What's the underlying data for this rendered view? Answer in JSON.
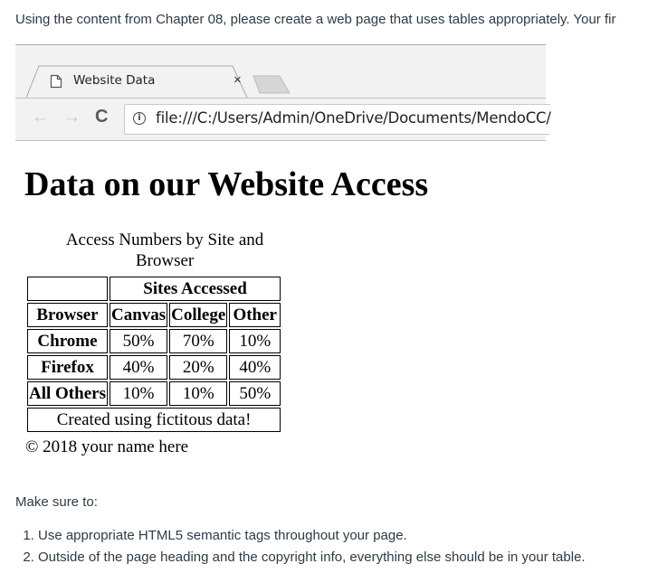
{
  "assignment": {
    "intro_text": "Using the content from Chapter 08, please create a web page that uses tables appropriately. Your fir",
    "make_sure_label": "Make sure to:",
    "requirements": [
      "Use appropriate HTML5 semantic tags throughout your page.",
      "Outside of the page heading and the copyright info, everything else should be in your table."
    ]
  },
  "browser": {
    "tab": {
      "title": "Website Data",
      "favicon": "document-icon",
      "close_label": "×"
    },
    "toolbar": {
      "back_label": "←",
      "forward_label": "→",
      "reload_label": "C",
      "info_label": "i",
      "url": "file:///C:/Users/Admin/OneDrive/Documents/MendoCC/"
    }
  },
  "webpage": {
    "heading": "Data on our Website Access",
    "table": {
      "caption": "Access Numbers by Site and Browser",
      "group_header": "Sites Accessed",
      "row_header_label": "Browser",
      "columns": [
        "Canvas",
        "College",
        "Other"
      ],
      "rows": [
        {
          "browser": "Chrome",
          "values": [
            "50%",
            "70%",
            "10%"
          ]
        },
        {
          "browser": "Firefox",
          "values": [
            "40%",
            "20%",
            "40%"
          ]
        },
        {
          "browser": "All Others",
          "values": [
            "10%",
            "10%",
            "50%"
          ]
        }
      ],
      "footer": "Created using fictitous data!"
    },
    "copyright": "© 2018 your name here"
  }
}
